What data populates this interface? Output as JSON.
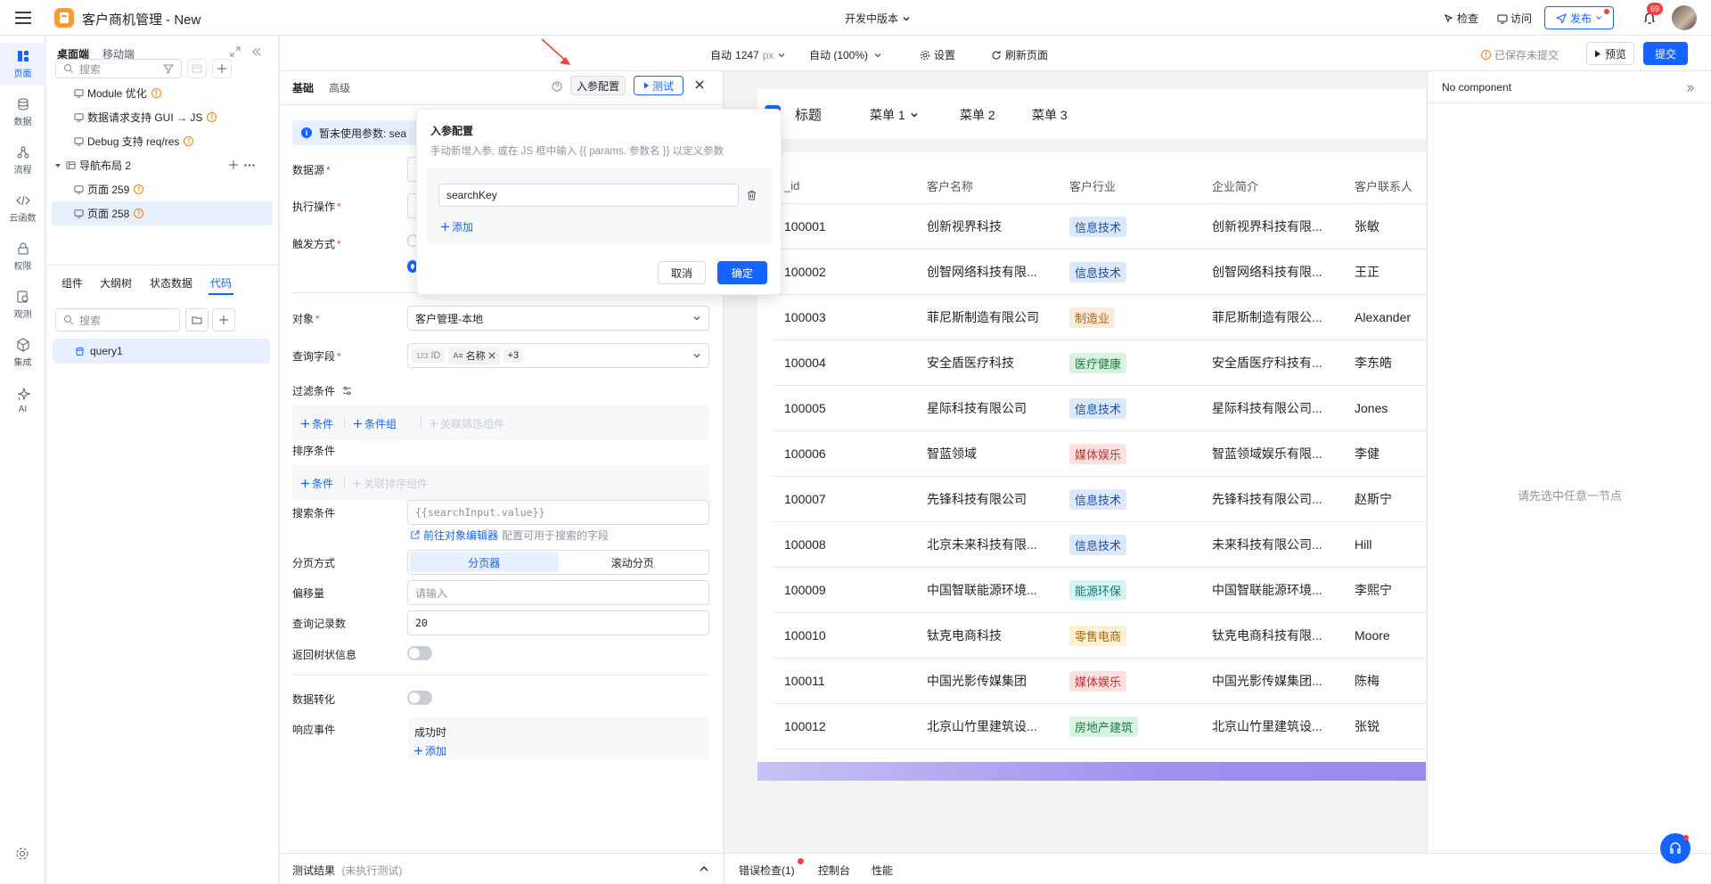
{
  "app": {
    "title": "客户商机管理 - New"
  },
  "topbar": {
    "version": "开发中版本",
    "inspect": "检查",
    "visit": "访问",
    "publish": "发布",
    "notify_count": "69"
  },
  "rail": [
    "页面",
    "数据",
    "流程",
    "云函数",
    "权限",
    "观测",
    "集成",
    "AI"
  ],
  "left_panel": {
    "tabs": [
      "桌面端",
      "移动端"
    ],
    "search_placeholder": "搜索",
    "tree": [
      {
        "label": "Module 优化"
      },
      {
        "label": "数据请求支持 GUI → JS"
      },
      {
        "label": "Debug 支持 req/res"
      },
      {
        "label": "导航布局 2"
      },
      {
        "label": "页面 259"
      },
      {
        "label": "页面 258"
      }
    ],
    "bottom_tabs": [
      "组件",
      "大纲树",
      "状态数据",
      "代码"
    ],
    "code_search_placeholder": "搜索",
    "query_item": "query1"
  },
  "toolbar": {
    "width_label": "自动",
    "width_value": "1247",
    "width_unit": "px",
    "zoom_label": "自动 (100%)",
    "settings": "设置",
    "refresh": "刷新页面",
    "saved_status": "已保存未提交",
    "preview": "预览",
    "submit": "提交"
  },
  "editor": {
    "tabs": [
      "基础",
      "高级"
    ],
    "param_config": "入参配置",
    "test": "测试",
    "notice": "暂未使用参数: sea",
    "datasource_label": "数据源",
    "operation_label": "执行操作",
    "trigger_label": "触发方式",
    "object_label": "对象",
    "object_value": "客户管理-本地",
    "fields_label": "查询字段",
    "field_tags": [
      "ID",
      "名称",
      "+3"
    ],
    "filter_label": "过滤条件",
    "add_condition": "条件",
    "add_group": "条件组",
    "link_filter": "关联筛选组件",
    "sort_label": "排序条件",
    "link_sort": "关联排序组件",
    "search_label": "搜索条件",
    "search_value": "{{searchInput.value}}",
    "goto_editor": "前往对象编辑器",
    "goto_hint": "配置可用于搜索的字段",
    "paging_label": "分页方式",
    "paging_options": [
      "分页器",
      "滚动分页"
    ],
    "offset_label": "偏移量",
    "offset_placeholder": "请输入",
    "limit_label": "查询记录数",
    "limit_value": "20",
    "tree_label": "返回树状信息",
    "transform_label": "数据转化",
    "event_label": "响应事件",
    "on_success": "成功时",
    "add": "添加",
    "test_result": "测试结果",
    "test_result_hint": "(未执行测试)"
  },
  "popover": {
    "title": "入参配置",
    "desc": "手动新增入参, 或在 JS 框中输入 {{ params. 参数名 }} 以定义参数",
    "param_value": "searchKey",
    "add": "添加",
    "cancel": "取消",
    "confirm": "确定"
  },
  "preview": {
    "logo_title": "标题",
    "menus": [
      "菜单 1",
      "菜单 2",
      "菜单 3"
    ],
    "columns": [
      "_id",
      "客户名称",
      "客户行业",
      "企业简介",
      "客户联系人"
    ],
    "rows": [
      [
        "100001",
        "创新视界科技",
        "信息技术",
        "创新视界科技有限...",
        "张敏"
      ],
      [
        "100002",
        "创智网络科技有限...",
        "信息技术",
        "创智网络科技有限...",
        "王正"
      ],
      [
        "100003",
        "菲尼斯制造有限公司",
        "制造业",
        "菲尼斯制造有限公...",
        "Alexander"
      ],
      [
        "100004",
        "安全盾医疗科技",
        "医疗健康",
        "安全盾医疗科技有...",
        "李东皓"
      ],
      [
        "100005",
        "星际科技有限公司",
        "信息技术",
        "星际科技有限公司...",
        "Jones"
      ],
      [
        "100006",
        "智蓝领域",
        "媒体娱乐",
        "智蓝领域娱乐有限...",
        "李健"
      ],
      [
        "100007",
        "先锋科技有限公司",
        "信息技术",
        "先锋科技有限公司...",
        "赵斯宁"
      ],
      [
        "100008",
        "北京未来科技有限...",
        "信息技术",
        "未来科技有限公司...",
        "Hill"
      ],
      [
        "100009",
        "中国智联能源环境...",
        "能源环保",
        "中国智联能源环境...",
        "李熙宁"
      ],
      [
        "100010",
        "钛克电商科技",
        "零售电商",
        "钛克电商科技有限...",
        "Moore"
      ],
      [
        "100011",
        "中国光影传媒集团",
        "媒体娱乐",
        "中国光影传媒集团...",
        "陈梅"
      ],
      [
        "100012",
        "北京山竹里建筑设...",
        "房地产建筑",
        "北京山竹里建筑设...",
        "张锐"
      ]
    ],
    "tag_colors": {
      "信息技术": {
        "bg": "#dce8fb",
        "fg": "#1d4ea8"
      },
      "制造业": {
        "bg": "#fdebd9",
        "fg": "#b5620b"
      },
      "医疗健康": {
        "bg": "#d8f3e1",
        "fg": "#1a7a3c"
      },
      "媒体娱乐": {
        "bg": "#fde0e0",
        "fg": "#c22f2f"
      },
      "能源环保": {
        "bg": "#d6f4f4",
        "fg": "#0f7777"
      },
      "零售电商": {
        "bg": "#fdf0d4",
        "fg": "#a4670b"
      },
      "房地产建筑": {
        "bg": "#d8f3e1",
        "fg": "#1a7a3c"
      }
    }
  },
  "right_panel": {
    "title": "No component",
    "empty_hint": "请先选中任意一节点"
  },
  "bottom": {
    "tabs": [
      "错误检查(1)",
      "控制台",
      "性能"
    ]
  },
  "colors": {
    "accent": "#1664ff",
    "warn": "#ff7d00",
    "danger": "#f53f3f"
  }
}
